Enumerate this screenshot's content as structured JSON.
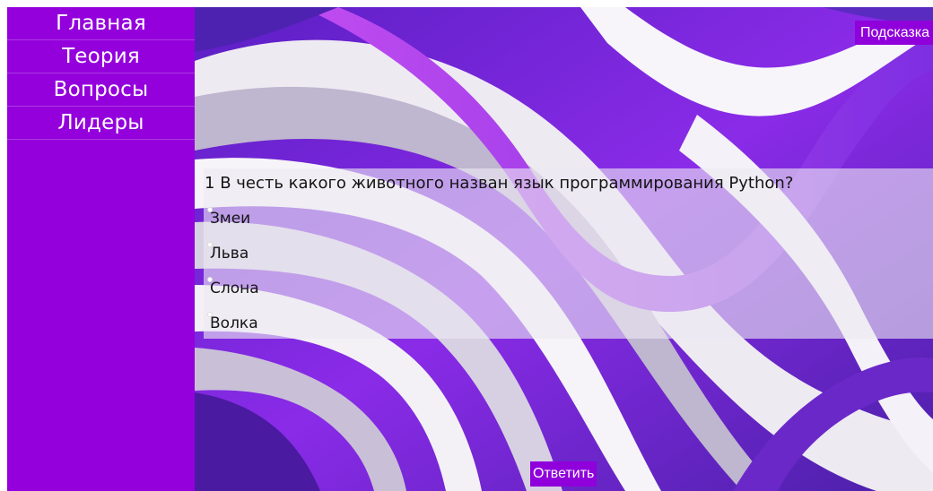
{
  "nav": {
    "items": [
      {
        "label": "Главная"
      },
      {
        "label": "Теория"
      },
      {
        "label": "Вопросы"
      },
      {
        "label": "Лидеры"
      }
    ]
  },
  "toolbar": {
    "hint_label": "Подсказка"
  },
  "quiz": {
    "question_number": "1",
    "question_text": "В честь какого животного назван язык программирования Python?",
    "options": [
      {
        "label": "Змеи",
        "selected": false
      },
      {
        "label": "Льва",
        "selected": false
      },
      {
        "label": "Слона",
        "selected": false
      },
      {
        "label": "Волка",
        "selected": false
      }
    ],
    "submit_label": "Ответить"
  },
  "colors": {
    "accent": "#9400dc",
    "button": "#8f00db",
    "wallpaper_purple": "#7a2fe0",
    "wallpaper_white": "#f2f0f4"
  }
}
